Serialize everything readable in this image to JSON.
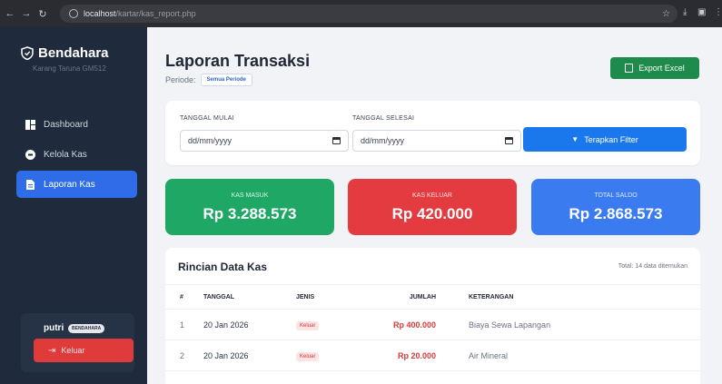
{
  "browser": {
    "url_host": "localhost",
    "url_path": "/kartar/kas_report.php"
  },
  "sidebar": {
    "brand": "Bendahara",
    "subtitle": "Karang Taruna GM512",
    "items": [
      {
        "label": "Dashboard",
        "icon": "dashboard-icon",
        "active": false
      },
      {
        "label": "Kelola Kas",
        "icon": "wallet-icon",
        "active": false
      },
      {
        "label": "Laporan Kas",
        "icon": "document-icon",
        "active": true
      }
    ],
    "user": {
      "name": "putri",
      "role": "BENDAHARA"
    },
    "logout_label": "Keluar"
  },
  "header": {
    "title": "Laporan Transaksi",
    "periode_label": "Periode:",
    "periode_value": "Semua Periode",
    "export_label": "Export Excel"
  },
  "filter": {
    "start_label": "TANGGAL MULAI",
    "start_value": "dd/mm/yyyy",
    "end_label": "TANGGAL SELESAI",
    "end_value": "dd/mm/yyyy",
    "apply_label": "Terapkan Filter"
  },
  "stats": {
    "masuk_label": "KAS MASUK",
    "masuk_value": "Rp 3.288.573",
    "keluar_label": "KAS KELUAR",
    "keluar_value": "Rp 420.000",
    "saldo_label": "TOTAL SALDO",
    "saldo_value": "Rp 2.868.573"
  },
  "table": {
    "title": "Rincian Data Kas",
    "total_text": "Total: 14 data ditemukan",
    "headers": {
      "no": "#",
      "tanggal": "TANGGAL",
      "jenis": "JENIS",
      "jumlah": "JUMLAH",
      "keterangan": "KETERANGAN"
    },
    "rows": [
      {
        "no": "1",
        "tanggal": "20 Jan 2026",
        "jenis": "Keluar",
        "jumlah": "Rp 400.000",
        "keterangan": "Biaya Sewa Lapangan"
      },
      {
        "no": "2",
        "tanggal": "20 Jan 2026",
        "jenis": "Keluar",
        "jumlah": "Rp 20.000",
        "keterangan": "Air Mineral"
      }
    ]
  },
  "colors": {
    "sidebar_bg": "#1f2a3c",
    "accent_blue": "#2f6ce8",
    "green": "#1fa865",
    "red": "#e33b3f",
    "blue": "#3a7bf0"
  }
}
